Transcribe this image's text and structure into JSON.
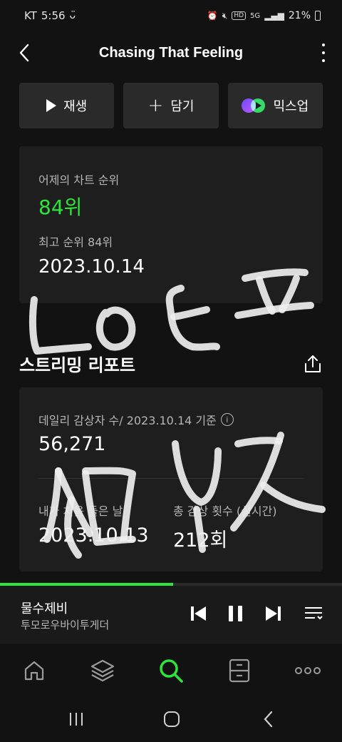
{
  "status_bar": {
    "carrier": "KT",
    "time": "5:56",
    "battery": "21%",
    "network": "5G",
    "hd_badge": "HD"
  },
  "header": {
    "title": "Chasing That Feeling"
  },
  "actions": {
    "play_label": "재생",
    "add_label": "담기",
    "mixup_label": "믹스업"
  },
  "chart": {
    "label": "어제의 차트 순위",
    "rank": "84위",
    "best_label": "최고 순위 84위",
    "best_date": "2023.10.14"
  },
  "report": {
    "section_title": "스트리밍 리포트",
    "daily_label": "데일리 감상자 수/ 2023.10.14 기준",
    "daily_count": "56,271",
    "first_listen_label": "내가 처음 들은 날",
    "first_listen_date": "2023.10.13",
    "total_plays_label": "총 감상 횟수 (실시간)",
    "total_plays_value": "212회"
  },
  "mini_player": {
    "track": "물수제비",
    "artist": "투모로우바이투게더",
    "progress": 0.506
  },
  "colors": {
    "accent": "#2ee53a",
    "background": "#121212",
    "card": "#1e1e1e",
    "button": "#2a2a2a"
  },
  "icons": {
    "back": "chevron-left-icon",
    "more": "more-vertical-icon",
    "share": "share-icon",
    "nav": [
      "home-icon",
      "layers-icon",
      "search-icon",
      "storage-icon",
      "more-horizontal-icon"
    ]
  }
}
